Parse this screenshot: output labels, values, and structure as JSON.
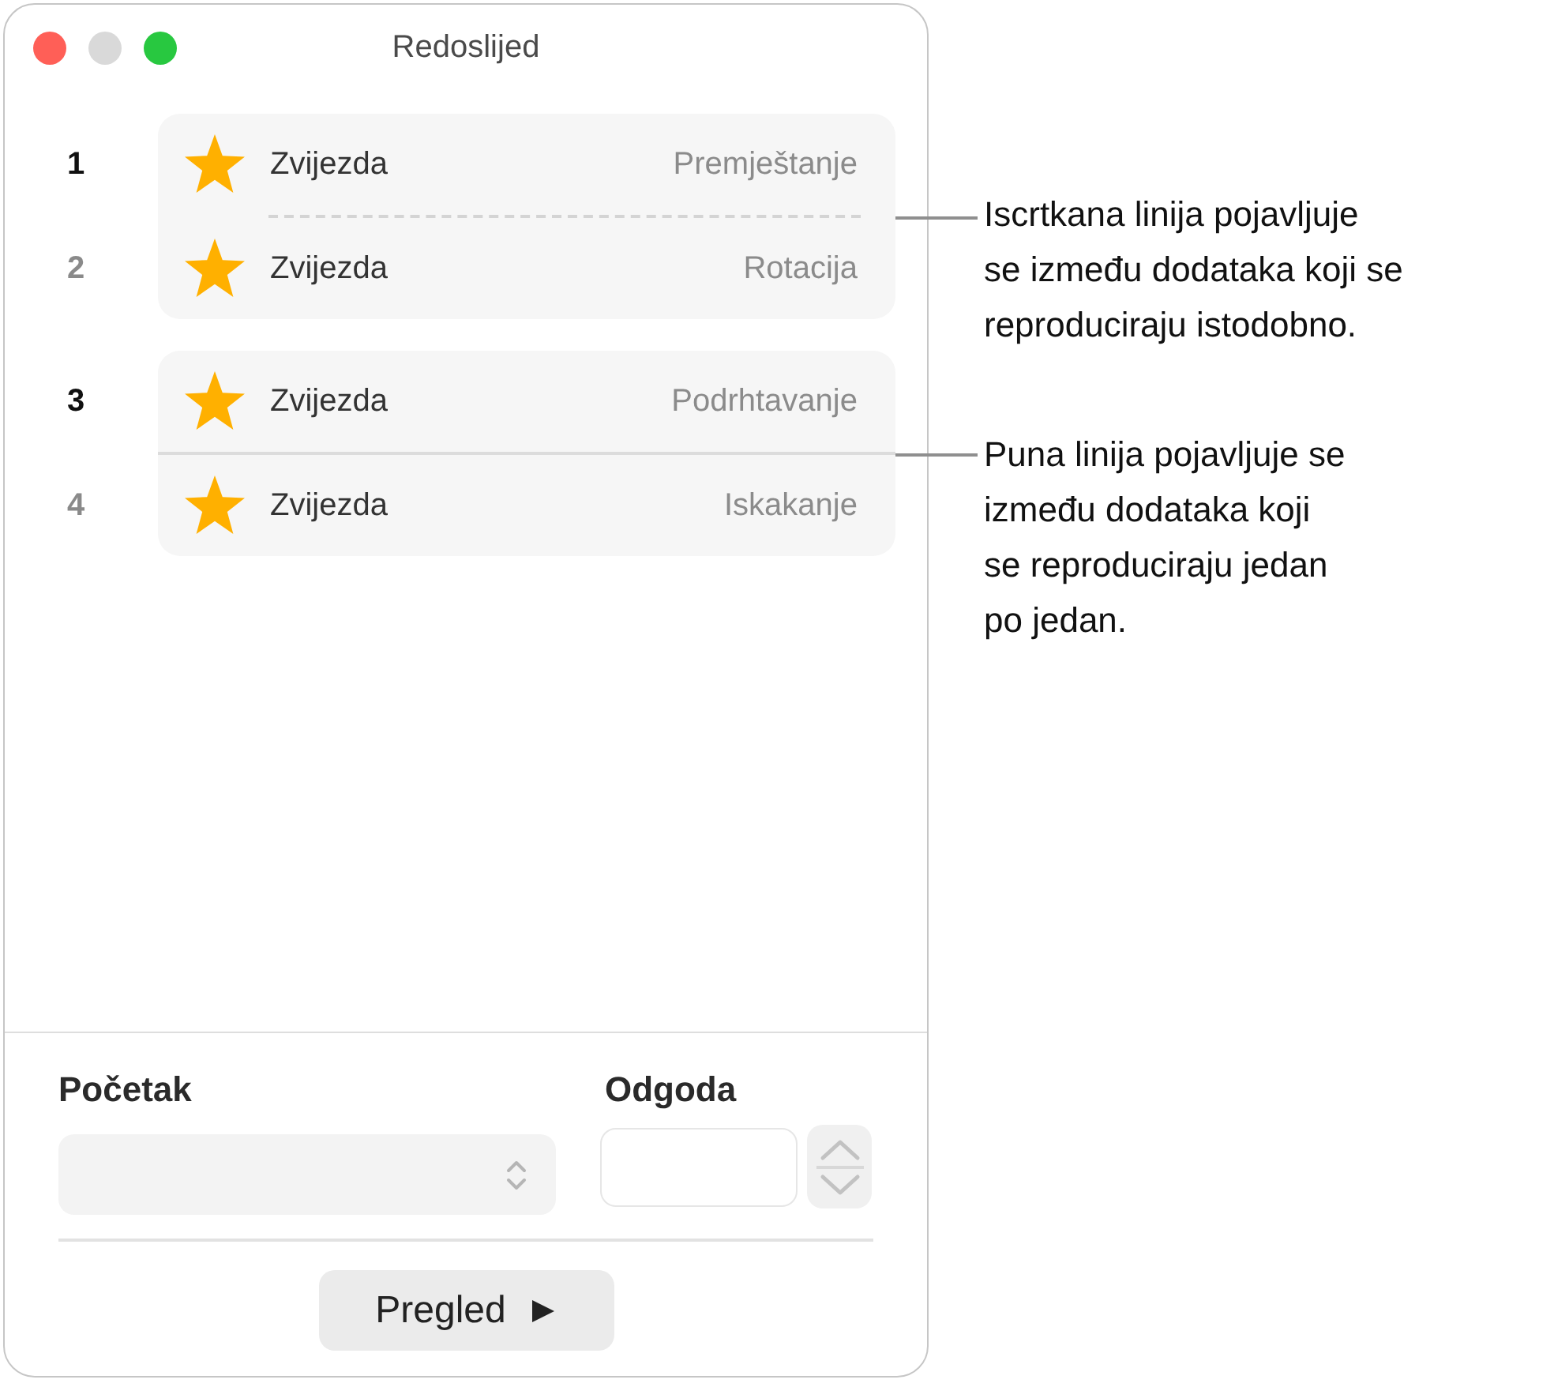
{
  "window": {
    "title": "Redoslijed",
    "controls": [
      {
        "kind": "close",
        "disabled": false
      },
      {
        "kind": "minimize",
        "disabled": true
      },
      {
        "kind": "zoom",
        "disabled": false
      }
    ]
  },
  "groups": [
    {
      "kind": "dashed",
      "items": [
        {
          "number": "1",
          "dimmed": false,
          "name": "Zvijezda",
          "effect": "Premještanje"
        },
        {
          "number": "2",
          "dimmed": true,
          "name": "Zvijezda",
          "effect": "Rotacija"
        }
      ]
    },
    {
      "kind": "solid",
      "items": [
        {
          "number": "3",
          "dimmed": false,
          "name": "Zvijezda",
          "effect": "Podrhtavanje"
        },
        {
          "number": "4",
          "dimmed": true,
          "name": "Zvijezda",
          "effect": "Iskakanje"
        }
      ]
    }
  ],
  "start": {
    "label": "Početak"
  },
  "delay": {
    "label": "Odgoda"
  },
  "preview_button": {
    "label": "Pregled"
  },
  "callouts": [
    {
      "text": "Iscrtkana linija pojavljuje\nse između dodataka koji se\nreproduciraju istodobno."
    },
    {
      "text": "Puna linija pojavljuje se\nizmeđu dodataka koji\nse reproduciraju jedan\npo jedan."
    }
  ]
}
